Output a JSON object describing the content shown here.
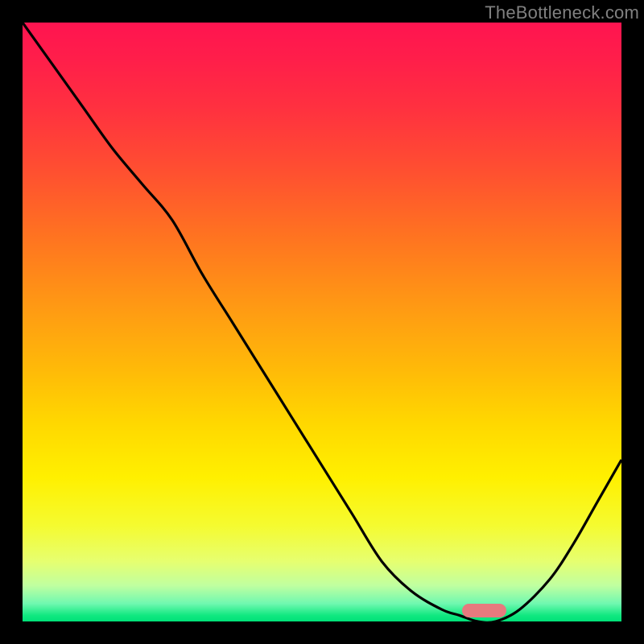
{
  "watermark": "TheBottleneck.com",
  "colors": {
    "border": "#000000",
    "curve": "#000000",
    "marker": "#e77a7e",
    "gradient_top": "#ff1450",
    "gradient_bottom": "#00e078"
  },
  "chart_data": {
    "type": "line",
    "title": "",
    "xlabel": "",
    "ylabel": "",
    "xlim": [
      0,
      100
    ],
    "ylim": [
      0,
      100
    ],
    "x": [
      0,
      5,
      10,
      15,
      20,
      25,
      30,
      35,
      40,
      45,
      50,
      55,
      60,
      65,
      70,
      73,
      76,
      79,
      83,
      88,
      92,
      96,
      100
    ],
    "values": [
      100,
      93,
      86,
      79,
      73,
      67,
      58,
      50,
      42,
      34,
      26,
      18,
      10,
      5,
      2,
      1,
      0,
      0,
      2,
      7,
      13,
      20,
      27
    ],
    "marker_x": 77,
    "marker_y": 0,
    "annotations": []
  }
}
